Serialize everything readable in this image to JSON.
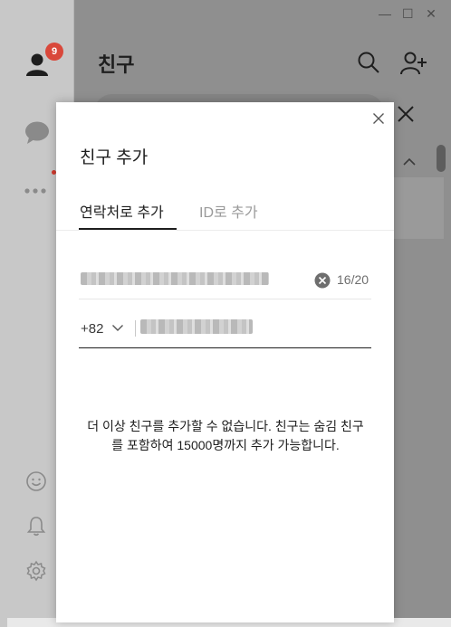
{
  "window": {
    "minimize": "—",
    "maximize": "☐",
    "close": "✕"
  },
  "sidebar": {
    "friends_badge": "9",
    "icons": [
      "person-icon",
      "chat-icon",
      "more-icon",
      "emoji-icon",
      "bell-icon",
      "gear-icon"
    ]
  },
  "main": {
    "title": "친구"
  },
  "modal": {
    "title": "친구 추가",
    "tabs": [
      {
        "label": "연락처로 추가",
        "active": true
      },
      {
        "label": "ID로 추가",
        "active": false
      }
    ],
    "name_field": {
      "value": "",
      "char_count": "16/20"
    },
    "phone_field": {
      "country_code": "+82",
      "value": ""
    },
    "limit_message": "더 이상 친구를 추가할 수 없습니다. 친구는 숨김 친구를 포함하여 15000명까지 추가 가능합니다."
  },
  "colors": {
    "badge": "#d9483b",
    "active_tab": "#1e1e1e",
    "inactive_tab": "#9a9a9a"
  }
}
